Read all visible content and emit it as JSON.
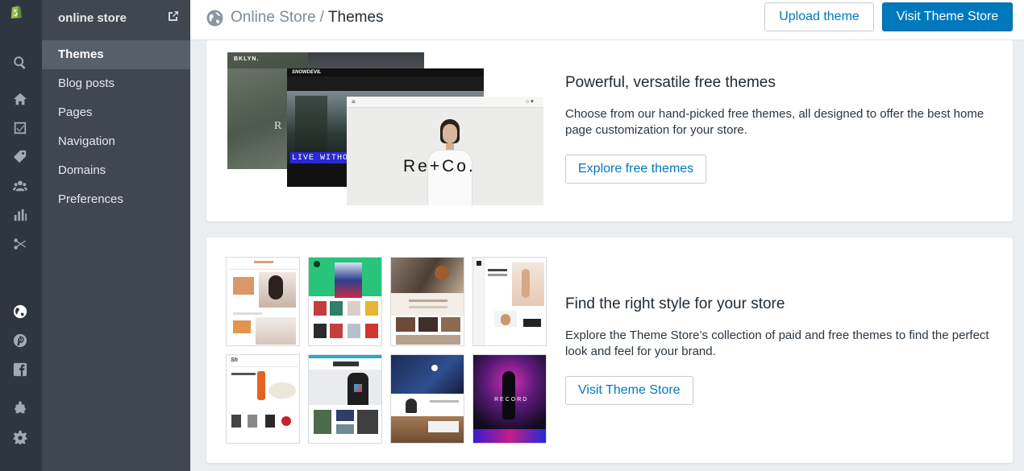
{
  "sidebar": {
    "title": "online store",
    "items": [
      {
        "label": "Themes"
      },
      {
        "label": "Blog posts"
      },
      {
        "label": "Pages"
      },
      {
        "label": "Navigation"
      },
      {
        "label": "Domains"
      },
      {
        "label": "Preferences"
      }
    ],
    "active": "Themes"
  },
  "header": {
    "breadcrumb_parent": "Online Store",
    "breadcrumb_separator": "/",
    "breadcrumb_current": "Themes",
    "upload_label": "Upload theme",
    "visit_label": "Visit Theme Store"
  },
  "free_themes": {
    "title": "Powerful, versatile free themes",
    "description": "Choose from our hand-picked free themes, all designed to offer the best home page customization for your store.",
    "button_label": "Explore free themes",
    "preview_texts": {
      "brand_a": "BKLYN.",
      "brand_b": "SNOWDEVIL",
      "banner": "LIVE WITHOUT",
      "brand_c": "Re+Co."
    }
  },
  "theme_store": {
    "title": "Find the right style for your store",
    "description": "Explore the Theme Store’s collection of paid and free themes to find the perfect look and feel for your brand.",
    "button_label": "Visit Theme Store",
    "thumbnail_texts": {
      "record": "RECORD"
    }
  },
  "colors": {
    "accent": "#0078bd",
    "rail_bg": "#2e3640",
    "sidebar_bg": "#3f4850",
    "active_bg": "#566069",
    "page_bg": "#ebeef0"
  },
  "icons": [
    "shopify-logo-icon",
    "search-icon",
    "home-icon",
    "orders-icon",
    "products-icon",
    "customers-icon",
    "reports-icon",
    "discounts-icon",
    "online-store-icon",
    "pinterest-icon",
    "facebook-icon",
    "apps-icon",
    "settings-icon",
    "external-link-icon"
  ]
}
